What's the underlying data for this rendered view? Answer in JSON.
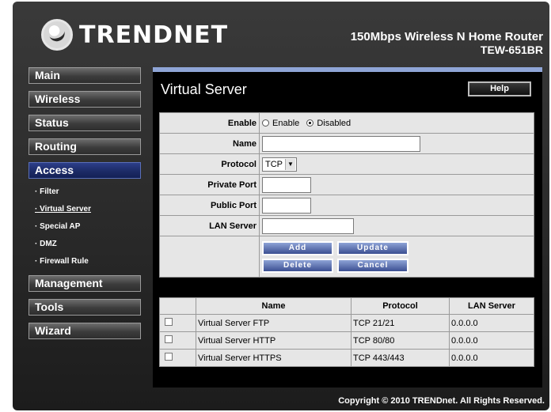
{
  "header": {
    "logo_text": "TRENDNET",
    "product_line": "150Mbps Wireless N Home Router",
    "model": "TEW-651BR"
  },
  "sidebar": {
    "items": [
      {
        "label": "Main"
      },
      {
        "label": "Wireless"
      },
      {
        "label": "Status"
      },
      {
        "label": "Routing"
      },
      {
        "label": "Access"
      },
      {
        "label": "Management"
      },
      {
        "label": "Tools"
      },
      {
        "label": "Wizard"
      }
    ],
    "access_sub": [
      {
        "label": "· Filter"
      },
      {
        "label": "· Virtual Server"
      },
      {
        "label": "· Special AP"
      },
      {
        "label": "· DMZ"
      },
      {
        "label": "· Firewall Rule"
      }
    ]
  },
  "page": {
    "title": "Virtual Server",
    "help_label": "Help"
  },
  "form": {
    "enable_label": "Enable",
    "enable_option": "Enable",
    "disabled_option": "Disabled",
    "enable_selected": "Disabled",
    "name_label": "Name",
    "name_value": "",
    "protocol_label": "Protocol",
    "protocol_value": "TCP",
    "private_port_label": "Private Port",
    "private_port_value": "",
    "public_port_label": "Public Port",
    "public_port_value": "",
    "lan_server_label": "LAN Server",
    "lan_server_value": "",
    "add_label": "Add",
    "update_label": "Update",
    "delete_label": "Delete",
    "cancel_label": "Cancel"
  },
  "table": {
    "headers": [
      "",
      "Name",
      "Protocol",
      "LAN Server"
    ],
    "rows": [
      {
        "name": "Virtual Server FTP",
        "protocol": "TCP 21/21",
        "lan_server": "0.0.0.0"
      },
      {
        "name": "Virtual Server HTTP",
        "protocol": "TCP 80/80",
        "lan_server": "0.0.0.0"
      },
      {
        "name": "Virtual Server HTTPS",
        "protocol": "TCP 443/443",
        "lan_server": "0.0.0.0"
      }
    ]
  },
  "footer": {
    "copyright": "Copyright © 2010 TRENDnet. All Rights Reserved."
  }
}
